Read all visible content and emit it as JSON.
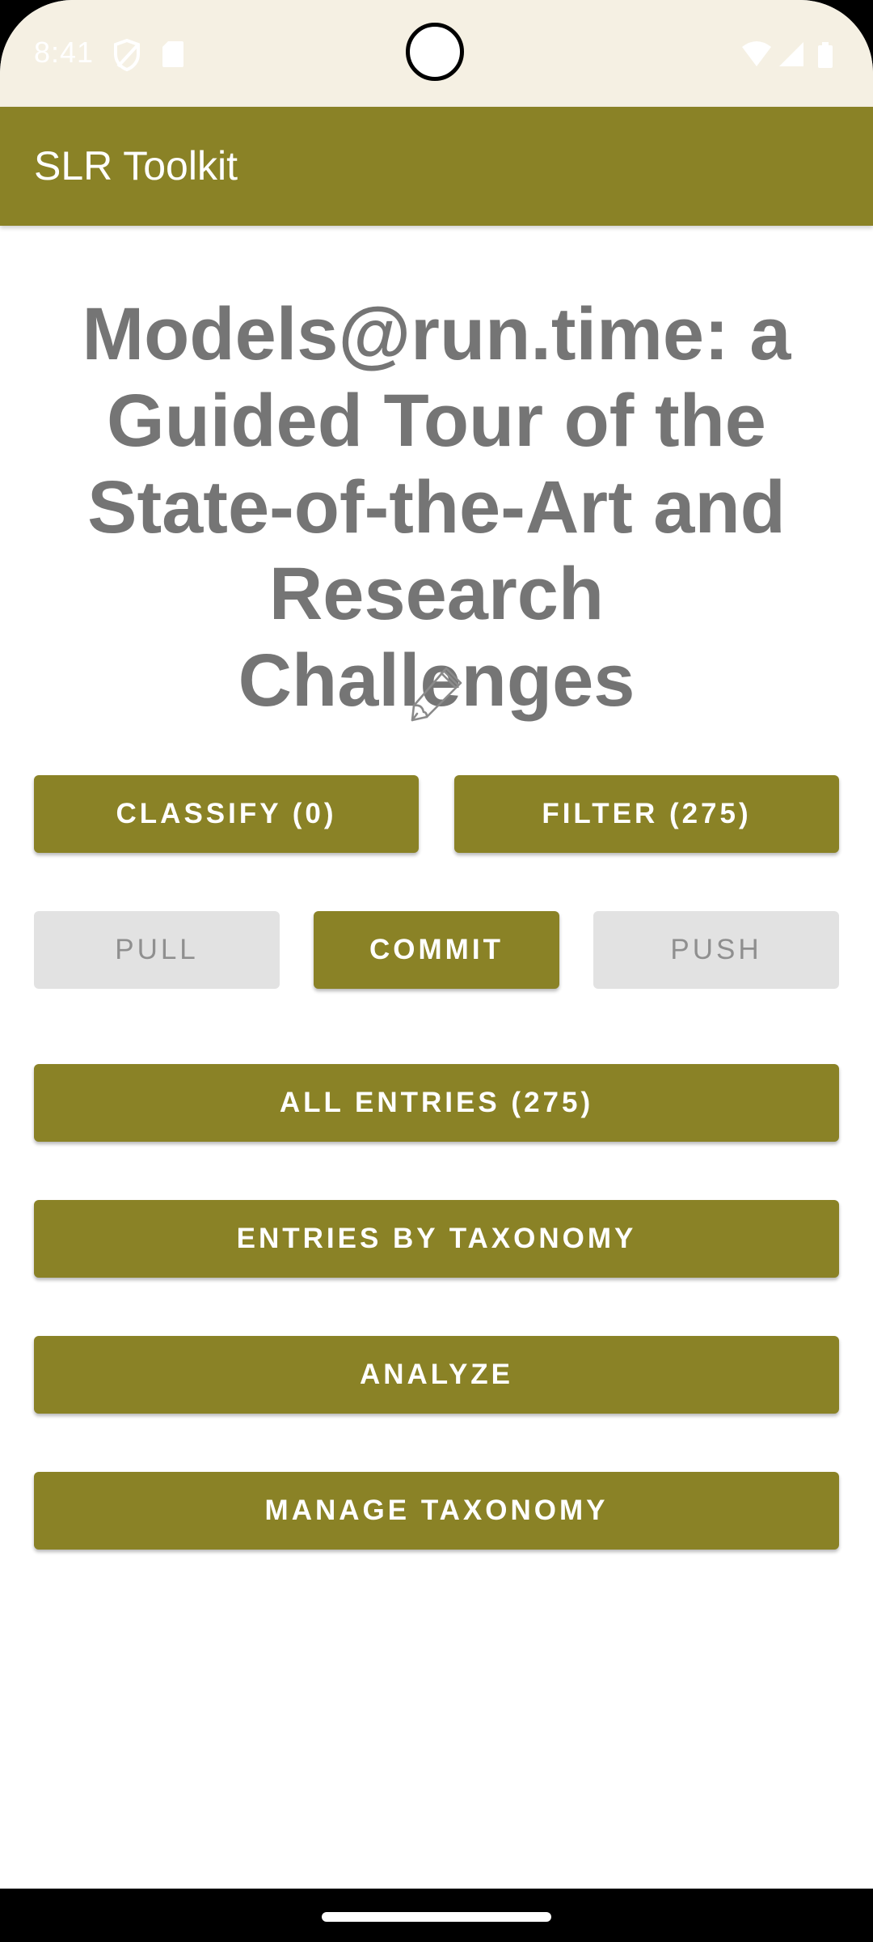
{
  "status_bar": {
    "time": "8:41",
    "icons": [
      "shield-icon",
      "sd-card-icon",
      "wifi-icon",
      "cell-signal-icon",
      "battery-icon"
    ]
  },
  "app_bar": {
    "title": "SLR Toolkit"
  },
  "project": {
    "title": "Models@run.time: a Guided Tour of the State-of-the-Art and Research Challenges",
    "edit_icon": "pencil-icon"
  },
  "buttons": {
    "classify": "CLASSIFY (0)",
    "filter": "FILTER (275)",
    "pull": "PULL",
    "commit": "COMMIT",
    "push": "PUSH",
    "all_entries": "ALL ENTRIES (275)",
    "entries_by_taxonomy": "ENTRIES BY TAXONOMY",
    "analyze": "ANALYZE",
    "manage_taxonomy": "MANAGE TAXONOMY"
  },
  "colors": {
    "accent": "#8a8226",
    "status_bar_bg": "#f5f0e3",
    "title_text": "#757575",
    "disabled_bg": "#e2e2e2",
    "disabled_text": "#8f8f8f"
  }
}
